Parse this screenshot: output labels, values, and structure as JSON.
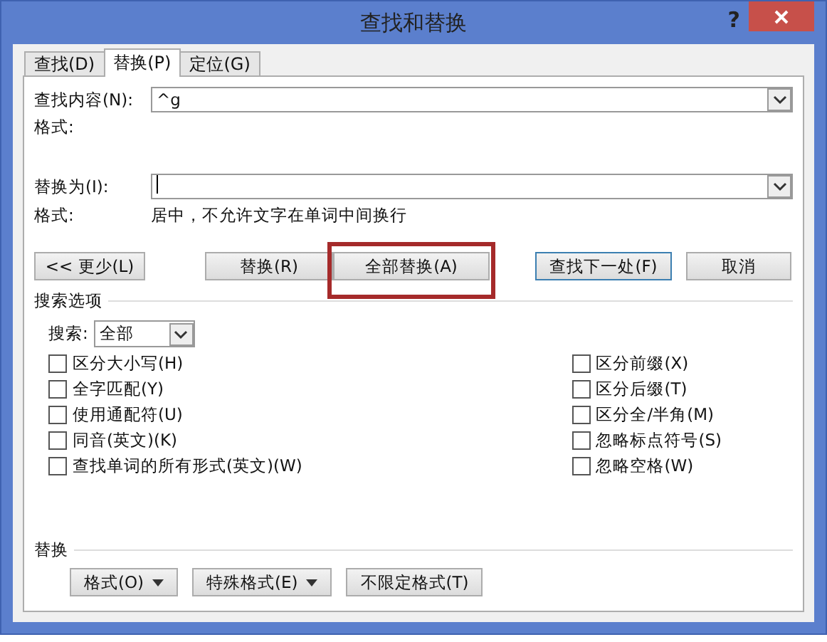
{
  "window": {
    "title": "查找和替换",
    "help": "?"
  },
  "tabs": [
    {
      "label": "查找(D)",
      "selected": false
    },
    {
      "label": "替换(P)",
      "selected": true
    },
    {
      "label": "定位(G)",
      "selected": false
    }
  ],
  "find": {
    "label": "查找内容(N):",
    "value": "^g",
    "format_label": "格式:"
  },
  "replace": {
    "label": "替换为(I):",
    "focused": true,
    "format_label": "格式:",
    "format_value": "居中，不允许文字在单词中间换行"
  },
  "buttons": [
    {
      "label": "<< 更少(L)",
      "highlighted": false,
      "default": false
    },
    {
      "label": "替换(R)",
      "highlighted": false,
      "default": false
    },
    {
      "label": "全部替换(A)",
      "highlighted": true,
      "default": false
    },
    {
      "label": "查找下一处(F)",
      "highlighted": false,
      "default": true
    },
    {
      "label": "取消",
      "highlighted": false,
      "default": false
    }
  ],
  "search_options": {
    "title": "搜索选项",
    "search_label": "搜索:",
    "search_value": "全部",
    "left": [
      {
        "label": "区分大小写(H)",
        "checked": false
      },
      {
        "label": "全字匹配(Y)",
        "checked": false
      },
      {
        "label": "使用通配符(U)",
        "checked": false
      },
      {
        "label": "同音(英文)(K)",
        "checked": false
      },
      {
        "label": "查找单词的所有形式(英文)(W)",
        "checked": false
      }
    ],
    "right": [
      {
        "label": "区分前缀(X)",
        "checked": false
      },
      {
        "label": "区分后缀(T)",
        "checked": false
      },
      {
        "label": "区分全/半角(M)",
        "checked": false
      },
      {
        "label": "忽略标点符号(S)",
        "checked": false
      },
      {
        "label": "忽略空格(W)",
        "checked": false
      }
    ]
  },
  "replace_section": {
    "title": "替换",
    "buttons": [
      {
        "label": "格式(O)",
        "kind": "dropdown"
      },
      {
        "label": "特殊格式(E)",
        "kind": "dropdown"
      },
      {
        "label": "不限定格式(T)",
        "kind": "plain"
      }
    ]
  }
}
